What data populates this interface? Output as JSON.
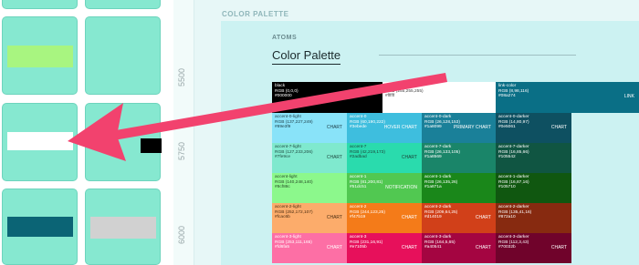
{
  "ruler": {
    "ticks": [
      "5500",
      "5750",
      "6000"
    ]
  },
  "board": {
    "label": "COLOR PALETTE",
    "section": "ATOMS",
    "title": "Color Palette"
  },
  "palette": {
    "row0": [
      {
        "name": "black",
        "rgb": "RGB (0,0,0)",
        "hex": "#000000",
        "tag": "",
        "bg": "#000000",
        "fg": "#ffffff"
      },
      {
        "name": "white",
        "rgb": "RGB (255,255,255)",
        "hex": "#ffffff",
        "tag": "",
        "bg": "#ffffff",
        "fg": "#444444"
      },
      {
        "name": "link-color",
        "rgb": "RGB (8,98,116)",
        "hex": "#08a274",
        "tag": "LINK",
        "bg": "#0a6f86",
        "fg": "#ffffff"
      }
    ],
    "rows": [
      [
        {
          "name": "accent-0-light",
          "rgb": "RGB (137,227,249)",
          "hex": "#89e3f9",
          "tag": "CHART",
          "bg": "#89e3f9",
          "fg": "#1d3c46"
        },
        {
          "name": "accent-0",
          "rgb": "RGB (60,190,222)",
          "hex": "#3ebede",
          "tag": "HOVER CHART",
          "bg": "#3ebede",
          "fg": "#ffffff"
        },
        {
          "name": "accent-0-dark",
          "rgb": "RGB (26,128,153)",
          "hex": "#1a8099",
          "tag": "PRIMARY CHART",
          "bg": "#1a8099",
          "fg": "#ffffff"
        },
        {
          "name": "accent-0-darker",
          "rgb": "RGB (14,80,97)",
          "hex": "#0e5061",
          "tag": "CHART",
          "bg": "#0e5061",
          "fg": "#ffffff"
        }
      ],
      [
        {
          "name": "accent-7-light",
          "rgb": "RGB (127,233,206)",
          "hex": "#7fe9ce",
          "tag": "CHART",
          "bg": "#7fe9ce",
          "fg": "#1f4a40"
        },
        {
          "name": "accent-7",
          "rgb": "RGB (42,219,173)",
          "hex": "#2adbad",
          "tag": "CHART",
          "bg": "#2adbad",
          "fg": "#1c3f36"
        },
        {
          "name": "accent-7-dark",
          "rgb": "RGB (26,133,105)",
          "hex": "#1a8569",
          "tag": "",
          "bg": "#1a8569",
          "fg": "#ffffff"
        },
        {
          "name": "accent-7-darker",
          "rgb": "RGB (16,85,66)",
          "hex": "#105542",
          "tag": "",
          "bg": "#105542",
          "fg": "#ffffff"
        }
      ],
      [
        {
          "name": "accent-light",
          "rgb": "RGB (140,248,140)",
          "hex": "#8cf88c",
          "tag": "",
          "bg": "#8cf88c",
          "fg": "#274a27"
        },
        {
          "name": "accent-1",
          "rgb": "RGB (81,200,81)",
          "hex": "#51dc51",
          "tag": "NOTIFICATION",
          "bg": "#51c851",
          "fg": "#ffffff"
        },
        {
          "name": "accent-1-dark",
          "rgb": "RGB (26,135,26)",
          "hex": "#1a871a",
          "tag": "",
          "bg": "#1a871a",
          "fg": "#ffffff"
        },
        {
          "name": "accent-1-darker",
          "rgb": "RGB (16,87,16)",
          "hex": "#105710",
          "tag": "",
          "bg": "#105710",
          "fg": "#ffffff"
        }
      ],
      [
        {
          "name": "accent-2-light",
          "rgb": "RGB (252,172,107)",
          "hex": "#fcac6b",
          "tag": "CHART",
          "bg": "#fcac6b",
          "fg": "#4a2d12"
        },
        {
          "name": "accent-2",
          "rgb": "RGB (244,123,25)",
          "hex": "#f47b19",
          "tag": "CHART",
          "bg": "#f47b19",
          "fg": "#ffffff"
        },
        {
          "name": "accent-2-dark",
          "rgb": "RGB (209,64,25)",
          "hex": "#d14019",
          "tag": "CHART",
          "bg": "#d14019",
          "fg": "#ffffff"
        },
        {
          "name": "accent-2-darker",
          "rgb": "RGB (135,41,16)",
          "hex": "#872a10",
          "tag": "",
          "bg": "#872a10",
          "fg": "#ffffff"
        }
      ],
      [
        {
          "name": "accent-3-light",
          "rgb": "RGB (253,111,165)",
          "hex": "#fd6fa5",
          "tag": "CHART",
          "bg": "#fd6fa5",
          "fg": "#ffffff"
        },
        {
          "name": "accent-3",
          "rgb": "RGB (231,16,91)",
          "hex": "#e7105b",
          "tag": "CHART",
          "bg": "#e7105b",
          "fg": "#ffffff"
        },
        {
          "name": "accent-3-dark",
          "rgb": "RGB (164,5,65)",
          "hex": "#a40541",
          "tag": "CHART",
          "bg": "#a40541",
          "fg": "#ffffff"
        },
        {
          "name": "accent-3-darker",
          "rgb": "RGB (112,3,43)",
          "hex": "#70032b",
          "tag": "CHART",
          "bg": "#70032b",
          "fg": "#ffffff"
        }
      ]
    ]
  },
  "colors": {
    "arrow": "#f2426e",
    "thumb": "#86e8d0"
  }
}
